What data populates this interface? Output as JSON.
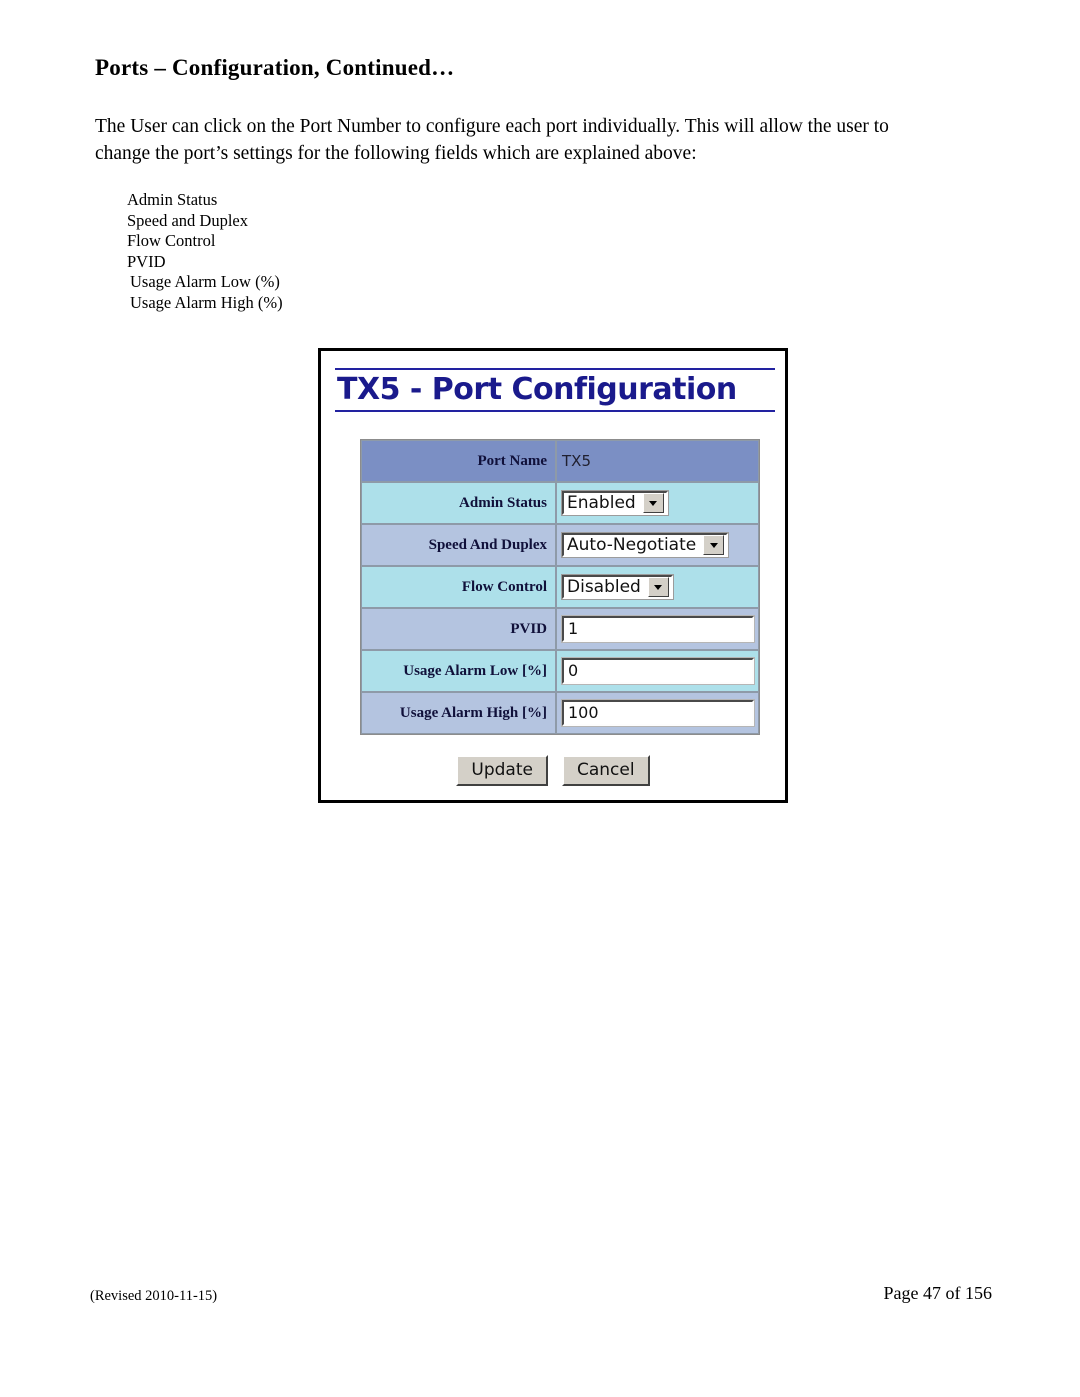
{
  "document": {
    "page_title": "Ports – Configuration, Continued…",
    "paragraph_line_1": "The User can click on the Port Number to configure each port individually.  This will allow the user to",
    "paragraph_line_2": "change the port’s settings for the following fields which are explained above:",
    "field_list": [
      "Admin Status",
      "Speed and Duplex",
      "Flow Control",
      "PVID",
      "Usage Alarm Low (%)",
      "Usage Alarm High (%)"
    ],
    "footer": {
      "revision": "(Revised 2010-11-15)",
      "page_number": "Page 47 of 156"
    }
  },
  "screenshot": {
    "app_heading": "TX5 - Port Configuration",
    "colors": {
      "heading_blue": "#1a1a8c",
      "row_header": "#7b8fc4",
      "row_cyan": "#ade0ea",
      "row_blue": "#b4c4e0",
      "button_face": "#d4d0c8"
    },
    "rows": [
      {
        "label": "Port Name",
        "control": "text",
        "value": "TX5"
      },
      {
        "label": "Admin Status",
        "control": "select",
        "value": "Enabled"
      },
      {
        "label": "Speed And Duplex",
        "control": "select",
        "value": "Auto-Negotiate"
      },
      {
        "label": "Flow Control",
        "control": "select",
        "value": "Disabled"
      },
      {
        "label": "PVID",
        "control": "input",
        "value": "1"
      },
      {
        "label": "Usage Alarm Low [%]",
        "control": "input",
        "value": "0"
      },
      {
        "label": "Usage Alarm High [%]",
        "control": "input",
        "value": "100"
      }
    ],
    "buttons": {
      "update": "Update",
      "cancel": "Cancel"
    }
  }
}
